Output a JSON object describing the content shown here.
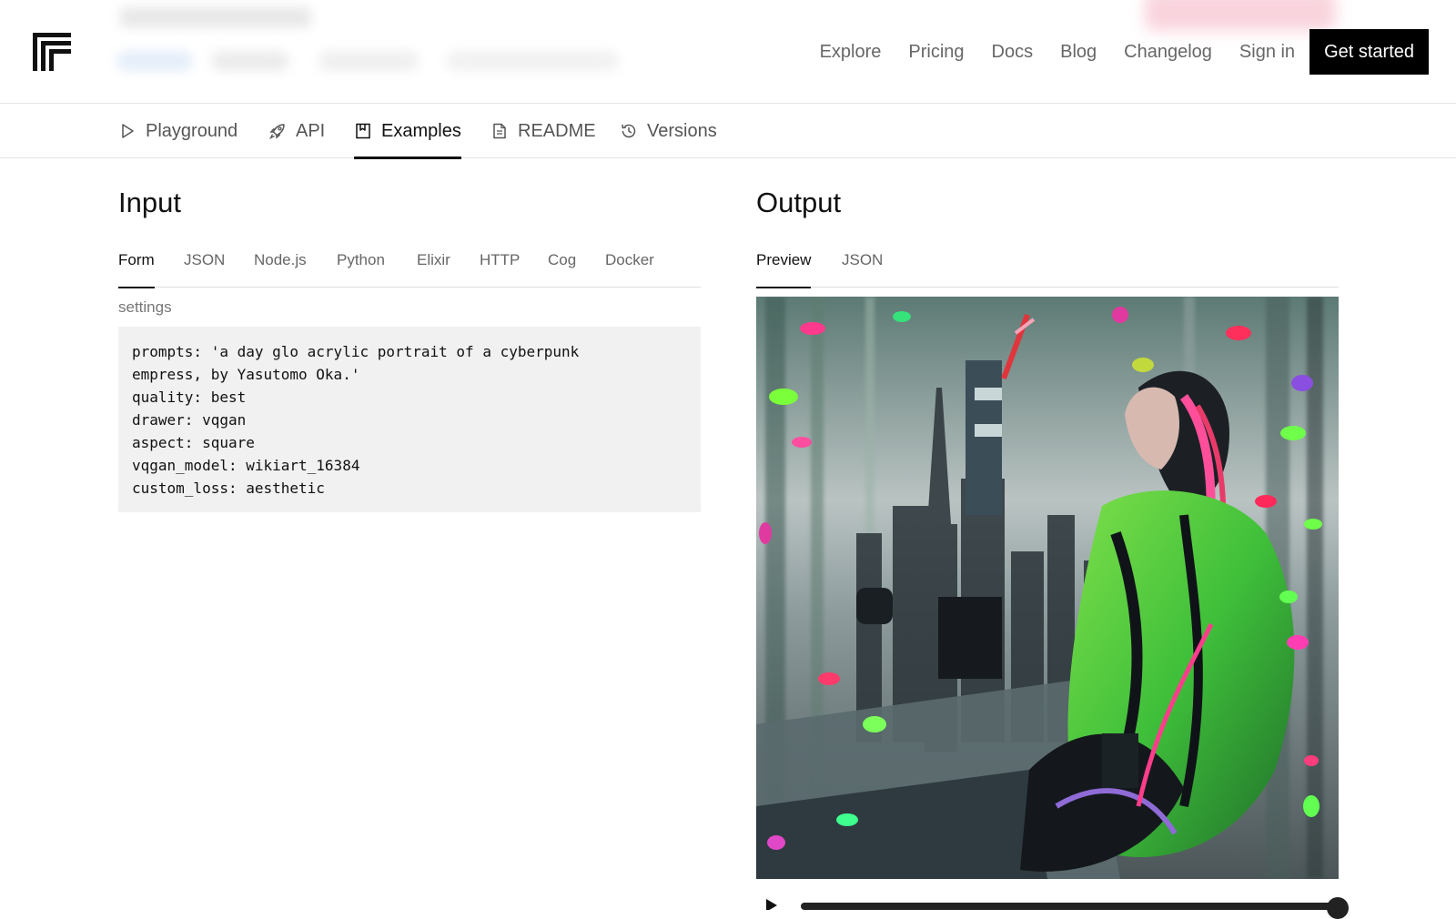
{
  "header": {
    "nav": [
      "Explore",
      "Pricing",
      "Docs",
      "Blog",
      "Changelog",
      "Sign in"
    ],
    "cta": "Get started"
  },
  "subnav": {
    "tabs": [
      {
        "label": "Playground",
        "icon": "play-icon"
      },
      {
        "label": "API",
        "icon": "rocket-icon"
      },
      {
        "label": "Examples",
        "icon": "bookmark-icon",
        "active": true
      },
      {
        "label": "README",
        "icon": "document-icon"
      },
      {
        "label": "Versions",
        "icon": "history-icon"
      }
    ]
  },
  "input": {
    "title": "Input",
    "tabs": [
      "Form",
      "JSON",
      "Node.js",
      "Python",
      "Elixir",
      "HTTP",
      "Cog",
      "Docker"
    ],
    "active_tab": "Form",
    "field_label": "settings",
    "settings_text": "prompts: 'a day glo acrylic portrait of a cyberpunk\nempress, by Yasutomo Oka.'\nquality: best\ndrawer: vqgan\naspect: square\nvqgan_model: wikiart_16384\ncustom_loss: aesthetic"
  },
  "output": {
    "title": "Output",
    "tabs": [
      "Preview",
      "JSON"
    ],
    "active_tab": "Preview",
    "image_icon": "generated-image",
    "player_icons": [
      "play-icon",
      "scrubber-knob"
    ]
  },
  "colors": {
    "accent": "#111111",
    "muted_text": "#666666",
    "code_bg": "#f1f1f1",
    "border": "#e4e4e4"
  }
}
